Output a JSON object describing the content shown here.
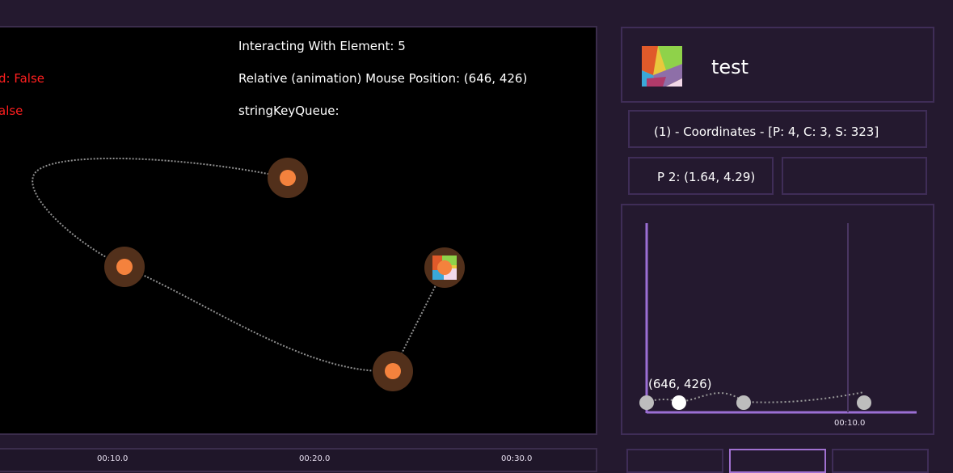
{
  "canvas": {
    "debug": {
      "interacting": "Interacting With Element: 5",
      "mouse_position": "Relative (animation) Mouse Position: (646, 426)",
      "key_queue": "stringKeyQueue:",
      "flag_1": "d: False",
      "flag_2": "alse"
    },
    "colors": {
      "point": "#f4823d",
      "halo": "#52301b",
      "path": "#8f8f8f",
      "flag_text": "#ff1f1f"
    }
  },
  "timeline": {
    "ticks": [
      "00:10.0",
      "00:20.0",
      "00:30.0"
    ]
  },
  "element": {
    "name": "test"
  },
  "coordinates": {
    "label": "(1) - Coordinates - [P: 4, C: 3, S: 323]"
  },
  "point_info": {
    "label": "P 2: (1.64, 4.29)",
    "secondary": ""
  },
  "graph": {
    "hover_label": "(646, 426)",
    "tick": "00:10.0",
    "colors": {
      "axis": "#9b6fd4",
      "marker": "#bdbdbd",
      "selected": "#ffffff"
    }
  },
  "buttons": [
    {
      "label": ""
    },
    {
      "label": ""
    },
    {
      "label": ""
    }
  ]
}
